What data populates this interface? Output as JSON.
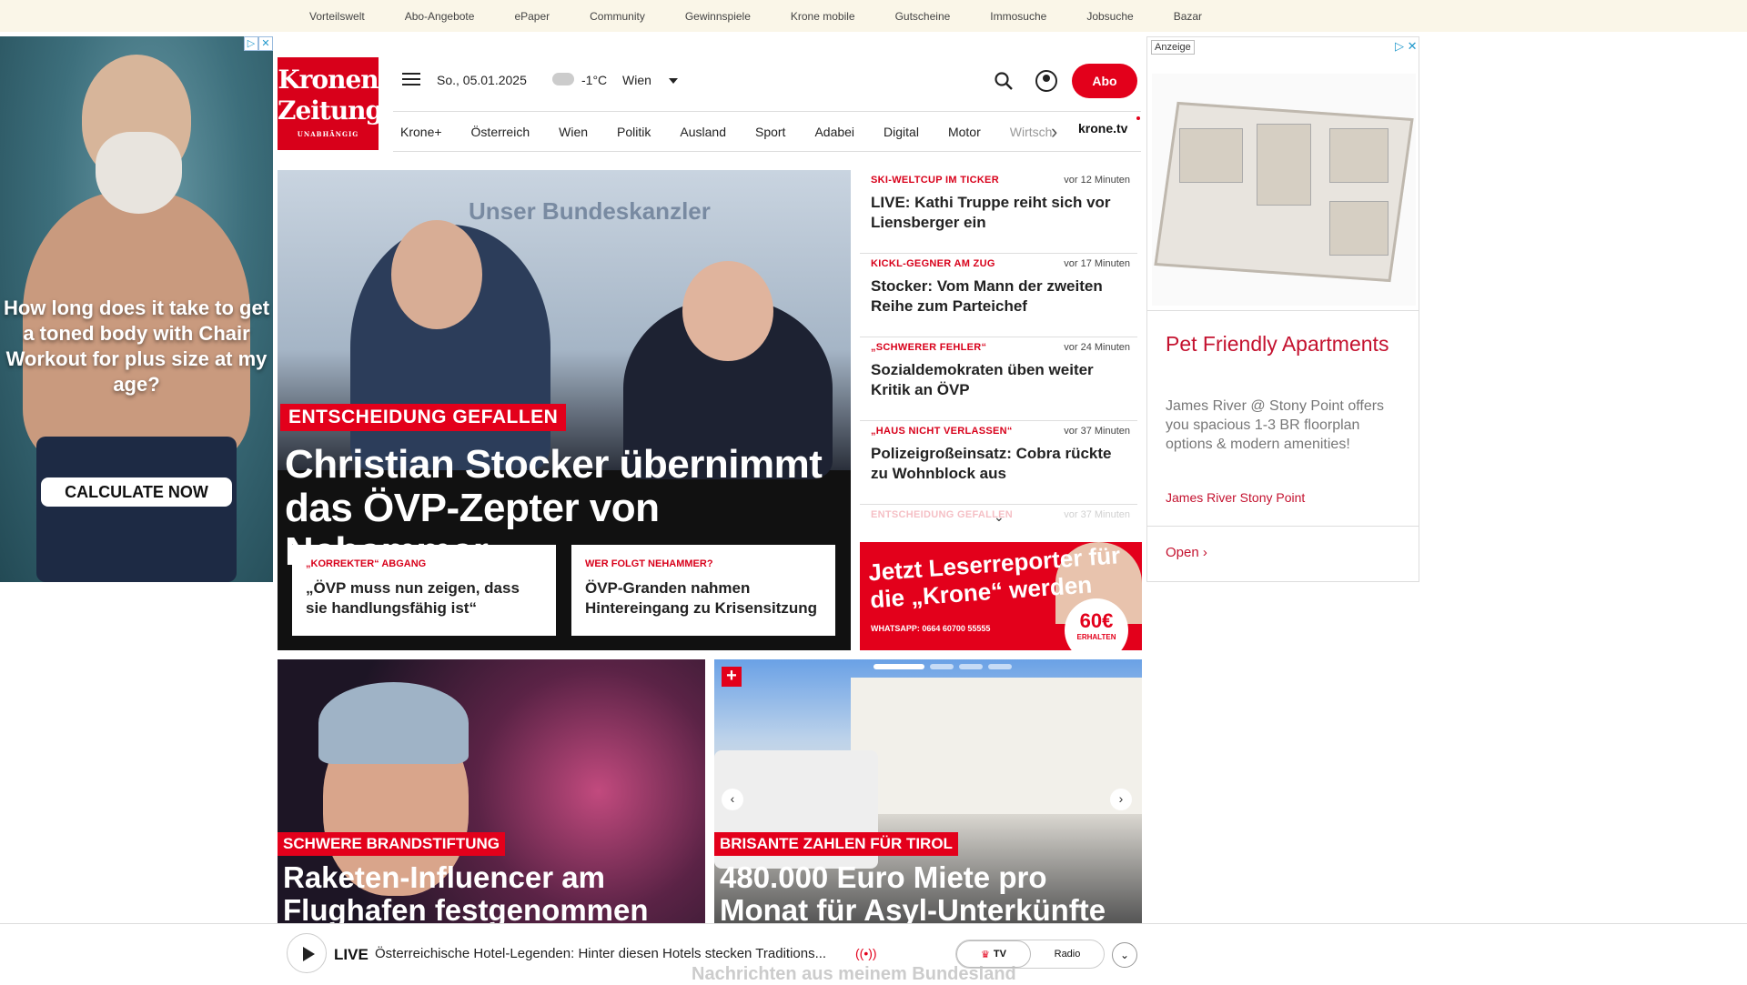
{
  "topbar": [
    "Vorteilswelt",
    "Abo-Angebote",
    "ePaper",
    "Community",
    "Gewinnspiele",
    "Krone mobile",
    "Gutscheine",
    "Immosuche",
    "Jobsuche",
    "Bazar"
  ],
  "ad_left": {
    "headline": "How long does it take to get a toned body with Chair Workout for plus size at my age?",
    "cta": "CALCULATE NOW"
  },
  "logo": {
    "line1": "Kronen",
    "line2": "Zeitung",
    "tagline": "UNABHÄNGIG"
  },
  "header": {
    "date": "So., 05.01.2025",
    "temp": "-1°C",
    "city": "Wien",
    "abo": "Abo"
  },
  "nav": {
    "items": [
      "Krone+",
      "Österreich",
      "Wien",
      "Politik",
      "Ausland",
      "Sport",
      "Adabei",
      "Digital",
      "Motor"
    ],
    "cut": "Wirtsch",
    "tv": "krone.tv"
  },
  "hero": {
    "bg_text": "Unser Bundeskanzler",
    "kicker": "ENTSCHEIDUNG GEFALLEN",
    "headline": "Christian Stocker übernimmt das ÖVP-Zepter von Nehammer",
    "sub": [
      {
        "kicker": "„KORREKTER“ ABGANG",
        "title": "„ÖVP muss nun zeigen, dass sie handlungsfähig ist“"
      },
      {
        "kicker": "WER FOLGT NEHAMMER?",
        "title": "ÖVP-Granden nahmen Hintereingang zu Krisensitzung"
      }
    ]
  },
  "ticker": [
    {
      "kicker": "SKI-WELTCUP IM TICKER",
      "time": "vor 12 Minuten",
      "title": "LIVE: Kathi Truppe reiht sich vor Liensberger ein"
    },
    {
      "kicker": "KICKL-GEGNER AM ZUG",
      "time": "vor 17 Minuten",
      "title": "Stocker: Vom Mann der zweiten Reihe zum Parteichef"
    },
    {
      "kicker": "„SCHWERER FEHLER“",
      "time": "vor 24 Minuten",
      "title": "Sozialdemokraten üben weiter Kritik an ÖVP"
    },
    {
      "kicker": "„HAUS NICHT VERLASSEN“",
      "time": "vor 37 Minuten",
      "title": "Polizeigroßeinsatz: Cobra rückte zu Wohnblock aus"
    },
    {
      "kicker": "ENTSCHEIDUNG GEFALLEN",
      "time": "vor 37 Minuten",
      "title": ""
    }
  ],
  "reporter": {
    "title": "Jetzt Leserreporter für die „Krone“ werden",
    "whatsapp": "WHATSAPP: 0664 60700 55555",
    "amount": "60€",
    "amount_sub": "ERHALTEN"
  },
  "cards": [
    {
      "kicker": "SCHWERE BRANDSTIFTUNG",
      "title": "Raketen-Influencer am Flughafen festgenommen"
    },
    {
      "kicker": "BRISANTE ZAHLEN FÜR TIROL",
      "title": "480.000 Euro Miete pro Monat für Asyl-Unterkünfte"
    }
  ],
  "ad_right": {
    "label": "Anzeige",
    "headline": "Pet Friendly Apartments",
    "desc": "James River @ Stony Point offers you spacious 1-3 BR floorplan options & modern amenities!",
    "advertiser": "James River Stony Point",
    "open": "Open"
  },
  "player": {
    "live": "LIVE",
    "title": "Österreichische Hotel-Legenden: Hinter diesen Hotels stecken Traditions...",
    "tv": "TV",
    "radio": "Radio",
    "bg_text": "Nachrichten aus meinem Bundesland"
  }
}
